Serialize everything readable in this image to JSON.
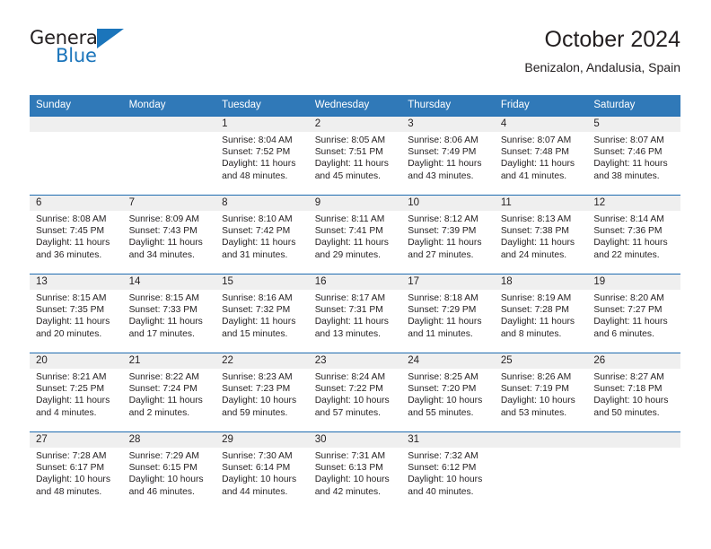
{
  "brand": {
    "name_top": "General",
    "name_bottom": "Blue",
    "accent_color": "#1b75bb"
  },
  "header": {
    "title": "October 2024",
    "subtitle": "Benizalon, Andalusia, Spain"
  },
  "theme": {
    "header_bg": "#3079b8",
    "row_border": "#1f6cb0",
    "daynum_band": "#efefef",
    "text": "#231f20"
  },
  "weekday_headers": [
    "Sunday",
    "Monday",
    "Tuesday",
    "Wednesday",
    "Thursday",
    "Friday",
    "Saturday"
  ],
  "labels": {
    "sunrise_prefix": "Sunrise:",
    "sunset_prefix": "Sunset:",
    "daylight_prefix": "Daylight:"
  },
  "weeks": [
    [
      {
        "day": "",
        "empty": true,
        "sunrise": "",
        "sunset": "",
        "daylight": ""
      },
      {
        "day": "",
        "empty": true,
        "sunrise": "",
        "sunset": "",
        "daylight": ""
      },
      {
        "day": "1",
        "empty": false,
        "sunrise": "Sunrise: 8:04 AM",
        "sunset": "Sunset: 7:52 PM",
        "daylight": "Daylight: 11 hours and 48 minutes."
      },
      {
        "day": "2",
        "empty": false,
        "sunrise": "Sunrise: 8:05 AM",
        "sunset": "Sunset: 7:51 PM",
        "daylight": "Daylight: 11 hours and 45 minutes."
      },
      {
        "day": "3",
        "empty": false,
        "sunrise": "Sunrise: 8:06 AM",
        "sunset": "Sunset: 7:49 PM",
        "daylight": "Daylight: 11 hours and 43 minutes."
      },
      {
        "day": "4",
        "empty": false,
        "sunrise": "Sunrise: 8:07 AM",
        "sunset": "Sunset: 7:48 PM",
        "daylight": "Daylight: 11 hours and 41 minutes."
      },
      {
        "day": "5",
        "empty": false,
        "sunrise": "Sunrise: 8:07 AM",
        "sunset": "Sunset: 7:46 PM",
        "daylight": "Daylight: 11 hours and 38 minutes."
      }
    ],
    [
      {
        "day": "6",
        "empty": false,
        "sunrise": "Sunrise: 8:08 AM",
        "sunset": "Sunset: 7:45 PM",
        "daylight": "Daylight: 11 hours and 36 minutes."
      },
      {
        "day": "7",
        "empty": false,
        "sunrise": "Sunrise: 8:09 AM",
        "sunset": "Sunset: 7:43 PM",
        "daylight": "Daylight: 11 hours and 34 minutes."
      },
      {
        "day": "8",
        "empty": false,
        "sunrise": "Sunrise: 8:10 AM",
        "sunset": "Sunset: 7:42 PM",
        "daylight": "Daylight: 11 hours and 31 minutes."
      },
      {
        "day": "9",
        "empty": false,
        "sunrise": "Sunrise: 8:11 AM",
        "sunset": "Sunset: 7:41 PM",
        "daylight": "Daylight: 11 hours and 29 minutes."
      },
      {
        "day": "10",
        "empty": false,
        "sunrise": "Sunrise: 8:12 AM",
        "sunset": "Sunset: 7:39 PM",
        "daylight": "Daylight: 11 hours and 27 minutes."
      },
      {
        "day": "11",
        "empty": false,
        "sunrise": "Sunrise: 8:13 AM",
        "sunset": "Sunset: 7:38 PM",
        "daylight": "Daylight: 11 hours and 24 minutes."
      },
      {
        "day": "12",
        "empty": false,
        "sunrise": "Sunrise: 8:14 AM",
        "sunset": "Sunset: 7:36 PM",
        "daylight": "Daylight: 11 hours and 22 minutes."
      }
    ],
    [
      {
        "day": "13",
        "empty": false,
        "sunrise": "Sunrise: 8:15 AM",
        "sunset": "Sunset: 7:35 PM",
        "daylight": "Daylight: 11 hours and 20 minutes."
      },
      {
        "day": "14",
        "empty": false,
        "sunrise": "Sunrise: 8:15 AM",
        "sunset": "Sunset: 7:33 PM",
        "daylight": "Daylight: 11 hours and 17 minutes."
      },
      {
        "day": "15",
        "empty": false,
        "sunrise": "Sunrise: 8:16 AM",
        "sunset": "Sunset: 7:32 PM",
        "daylight": "Daylight: 11 hours and 15 minutes."
      },
      {
        "day": "16",
        "empty": false,
        "sunrise": "Sunrise: 8:17 AM",
        "sunset": "Sunset: 7:31 PM",
        "daylight": "Daylight: 11 hours and 13 minutes."
      },
      {
        "day": "17",
        "empty": false,
        "sunrise": "Sunrise: 8:18 AM",
        "sunset": "Sunset: 7:29 PM",
        "daylight": "Daylight: 11 hours and 11 minutes."
      },
      {
        "day": "18",
        "empty": false,
        "sunrise": "Sunrise: 8:19 AM",
        "sunset": "Sunset: 7:28 PM",
        "daylight": "Daylight: 11 hours and 8 minutes."
      },
      {
        "day": "19",
        "empty": false,
        "sunrise": "Sunrise: 8:20 AM",
        "sunset": "Sunset: 7:27 PM",
        "daylight": "Daylight: 11 hours and 6 minutes."
      }
    ],
    [
      {
        "day": "20",
        "empty": false,
        "sunrise": "Sunrise: 8:21 AM",
        "sunset": "Sunset: 7:25 PM",
        "daylight": "Daylight: 11 hours and 4 minutes."
      },
      {
        "day": "21",
        "empty": false,
        "sunrise": "Sunrise: 8:22 AM",
        "sunset": "Sunset: 7:24 PM",
        "daylight": "Daylight: 11 hours and 2 minutes."
      },
      {
        "day": "22",
        "empty": false,
        "sunrise": "Sunrise: 8:23 AM",
        "sunset": "Sunset: 7:23 PM",
        "daylight": "Daylight: 10 hours and 59 minutes."
      },
      {
        "day": "23",
        "empty": false,
        "sunrise": "Sunrise: 8:24 AM",
        "sunset": "Sunset: 7:22 PM",
        "daylight": "Daylight: 10 hours and 57 minutes."
      },
      {
        "day": "24",
        "empty": false,
        "sunrise": "Sunrise: 8:25 AM",
        "sunset": "Sunset: 7:20 PM",
        "daylight": "Daylight: 10 hours and 55 minutes."
      },
      {
        "day": "25",
        "empty": false,
        "sunrise": "Sunrise: 8:26 AM",
        "sunset": "Sunset: 7:19 PM",
        "daylight": "Daylight: 10 hours and 53 minutes."
      },
      {
        "day": "26",
        "empty": false,
        "sunrise": "Sunrise: 8:27 AM",
        "sunset": "Sunset: 7:18 PM",
        "daylight": "Daylight: 10 hours and 50 minutes."
      }
    ],
    [
      {
        "day": "27",
        "empty": false,
        "sunrise": "Sunrise: 7:28 AM",
        "sunset": "Sunset: 6:17 PM",
        "daylight": "Daylight: 10 hours and 48 minutes."
      },
      {
        "day": "28",
        "empty": false,
        "sunrise": "Sunrise: 7:29 AM",
        "sunset": "Sunset: 6:15 PM",
        "daylight": "Daylight: 10 hours and 46 minutes."
      },
      {
        "day": "29",
        "empty": false,
        "sunrise": "Sunrise: 7:30 AM",
        "sunset": "Sunset: 6:14 PM",
        "daylight": "Daylight: 10 hours and 44 minutes."
      },
      {
        "day": "30",
        "empty": false,
        "sunrise": "Sunrise: 7:31 AM",
        "sunset": "Sunset: 6:13 PM",
        "daylight": "Daylight: 10 hours and 42 minutes."
      },
      {
        "day": "31",
        "empty": false,
        "sunrise": "Sunrise: 7:32 AM",
        "sunset": "Sunset: 6:12 PM",
        "daylight": "Daylight: 10 hours and 40 minutes."
      },
      {
        "day": "",
        "empty": true,
        "sunrise": "",
        "sunset": "",
        "daylight": ""
      },
      {
        "day": "",
        "empty": true,
        "sunrise": "",
        "sunset": "",
        "daylight": ""
      }
    ]
  ]
}
